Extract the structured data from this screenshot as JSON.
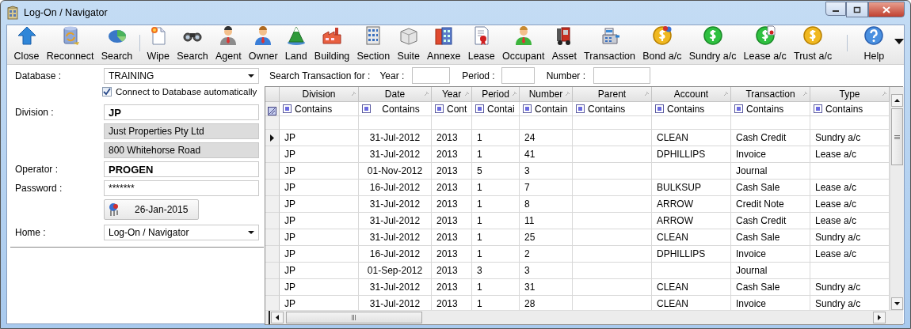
{
  "window": {
    "title": "Log-On / Navigator"
  },
  "toolbar": {
    "groups": [
      [
        {
          "label": "Close"
        },
        {
          "label": "Reconnect"
        },
        {
          "label": "Search"
        }
      ],
      [
        {
          "label": "Wipe"
        },
        {
          "label": "Search"
        },
        {
          "label": "Agent"
        },
        {
          "label": "Owner"
        },
        {
          "label": "Land"
        },
        {
          "label": "Building"
        },
        {
          "label": "Section"
        },
        {
          "label": "Suite"
        },
        {
          "label": "Annexe"
        },
        {
          "label": "Lease"
        },
        {
          "label": "Occupant"
        },
        {
          "label": "Asset"
        },
        {
          "label": "Transaction"
        },
        {
          "label": "Bond a/c"
        },
        {
          "label": "Sundry a/c"
        },
        {
          "label": "Lease a/c"
        },
        {
          "label": "Trust a/c"
        }
      ],
      [
        {
          "label": "Help"
        }
      ]
    ]
  },
  "login": {
    "database": {
      "label": "Database :",
      "value": "TRAINING"
    },
    "auto_connect": {
      "label": "Connect to Database automatically",
      "checked": true
    },
    "division": {
      "label": "Division :",
      "value": "JP",
      "name": "Just Properties Pty Ltd",
      "address": "800 Whitehorse Road"
    },
    "operator": {
      "label": "Operator :",
      "value": "PROGEN"
    },
    "password": {
      "label": "Password :",
      "value": "*******"
    },
    "date_button": "26-Jan-2015",
    "home": {
      "label": "Home :",
      "value": "Log-On / Navigator"
    }
  },
  "search": {
    "label": "Search Transaction for :",
    "fields": [
      {
        "label": "Year :"
      },
      {
        "label": "Period :"
      },
      {
        "label": "Number :"
      }
    ]
  },
  "grid": {
    "columns": [
      {
        "title": "Division",
        "filter": "Contains"
      },
      {
        "title": "Date",
        "filter": "Contains"
      },
      {
        "title": "Year",
        "filter": "Cont"
      },
      {
        "title": "Period",
        "filter": "Contai"
      },
      {
        "title": "Number",
        "filter": "Contain"
      },
      {
        "title": "Parent",
        "filter": "Contains"
      },
      {
        "title": "Account",
        "filter": "Contains"
      },
      {
        "title": "Transaction",
        "filter": "Contains"
      },
      {
        "title": "Type",
        "filter": "Contains"
      }
    ],
    "rows": [
      {
        "current": true,
        "cells": [
          "JP",
          "31-Jul-2012",
          "2013",
          "1",
          "24",
          null,
          "CLEAN",
          "Cash Credit",
          "Sundry a/c"
        ]
      },
      {
        "current": false,
        "cells": [
          "JP",
          "31-Jul-2012",
          "2013",
          "1",
          "41",
          null,
          "DPHILLIPS",
          "Invoice",
          "Lease a/c"
        ]
      },
      {
        "current": false,
        "cells": [
          "JP",
          "01-Nov-2012",
          "2013",
          "5",
          "3",
          null,
          null,
          "Journal",
          null
        ]
      },
      {
        "current": false,
        "cells": [
          "JP",
          "16-Jul-2012",
          "2013",
          "1",
          "7",
          null,
          "BULKSUP",
          "Cash Sale",
          "Lease a/c"
        ]
      },
      {
        "current": false,
        "cells": [
          "JP",
          "31-Jul-2012",
          "2013",
          "1",
          "8",
          null,
          "ARROW",
          "Credit Note",
          "Lease a/c"
        ]
      },
      {
        "current": false,
        "cells": [
          "JP",
          "31-Jul-2012",
          "2013",
          "1",
          "11",
          null,
          "ARROW",
          "Cash Credit",
          "Lease a/c"
        ]
      },
      {
        "current": false,
        "cells": [
          "JP",
          "31-Jul-2012",
          "2013",
          "1",
          "25",
          null,
          "CLEAN",
          "Cash Sale",
          "Sundry a/c"
        ]
      },
      {
        "current": false,
        "cells": [
          "JP",
          "16-Jul-2012",
          "2013",
          "1",
          "2",
          null,
          "DPHILLIPS",
          "Invoice",
          "Lease a/c"
        ]
      },
      {
        "current": false,
        "cells": [
          "JP",
          "01-Sep-2012",
          "2013",
          "3",
          "3",
          null,
          null,
          "Journal",
          null
        ]
      },
      {
        "current": false,
        "cells": [
          "JP",
          "31-Jul-2012",
          "2013",
          "1",
          "31",
          null,
          "CLEAN",
          "Cash Sale",
          "Sundry a/c"
        ]
      },
      {
        "current": false,
        "cells": [
          "JP",
          "31-Jul-2012",
          "2013",
          "1",
          "28",
          null,
          "CLEAN",
          "Invoice",
          "Sundry a/c"
        ]
      }
    ]
  }
}
